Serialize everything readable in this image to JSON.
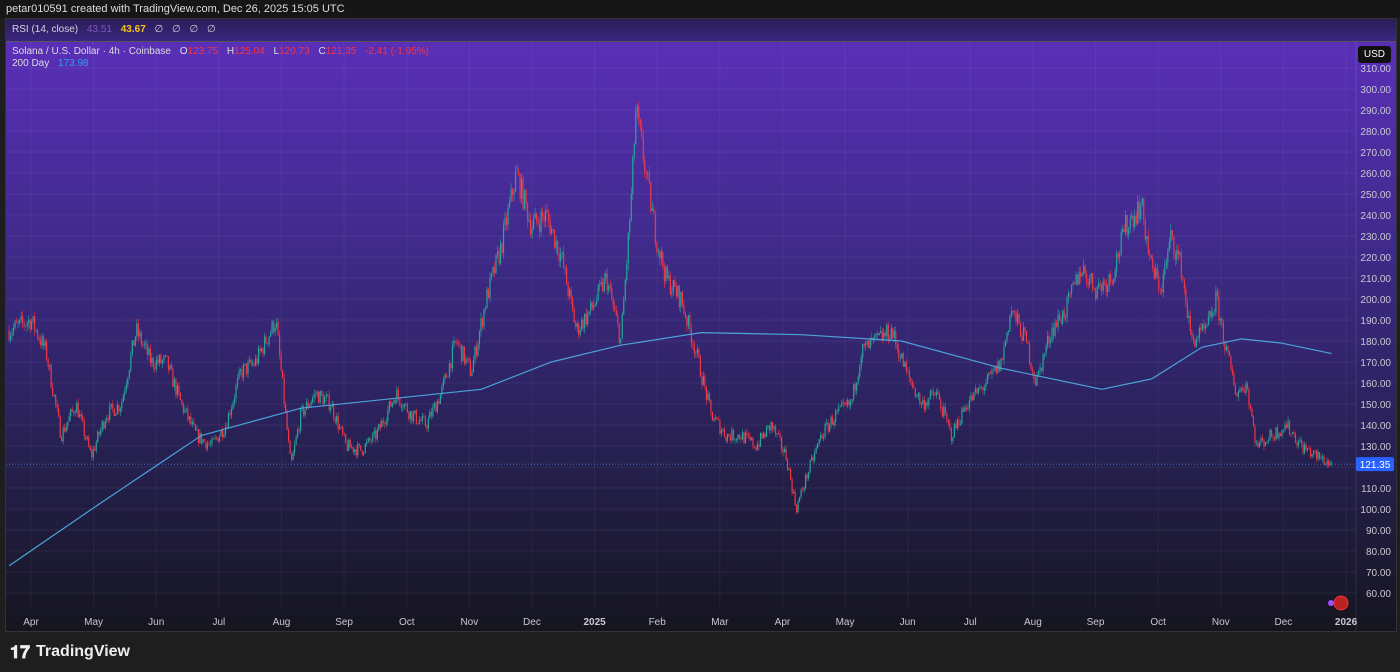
{
  "header": {
    "caption": "petar010591 created with TradingView.com, Dec 26, 2025 15:05 UTC"
  },
  "rsi": {
    "label": "RSI (14, close)",
    "value1": "43.51",
    "value2": "43.67",
    "nulls": [
      "∅",
      "∅",
      "∅",
      "∅"
    ]
  },
  "legend": {
    "symbol": "Solana / U.S. Dollar · 4h · Coinbase",
    "o_label": "O",
    "o": "123.75",
    "h_label": "H",
    "h": "125.04",
    "l_label": "L",
    "l": "120.73",
    "c_label": "C",
    "c": "121.35",
    "change": "-2.41 (-1.95%)",
    "ma_label": "200 Day",
    "ma_value": "173.98"
  },
  "currency": "USD",
  "brand": "TradingView",
  "colors": {
    "up": "#26a69a",
    "down": "#f23645",
    "ma": "#4aa3d9",
    "last": "#2962ff"
  },
  "chart_data": {
    "type": "candlestick",
    "title": "Solana / U.S. Dollar · 4h · Coinbase",
    "ylim": [
      55,
      315
    ],
    "yticks": [
      60,
      70,
      80,
      90,
      100,
      110,
      120,
      130,
      140,
      150,
      160,
      170,
      180,
      190,
      200,
      210,
      220,
      230,
      240,
      250,
      260,
      270,
      280,
      290,
      300,
      310
    ],
    "xticks": [
      {
        "t": 0,
        "label": "Apr"
      },
      {
        "t": 1,
        "label": "May"
      },
      {
        "t": 2,
        "label": "Jun"
      },
      {
        "t": 3,
        "label": "Jul"
      },
      {
        "t": 4,
        "label": "Aug"
      },
      {
        "t": 5,
        "label": "Sep"
      },
      {
        "t": 6,
        "label": "Oct"
      },
      {
        "t": 7,
        "label": "Nov"
      },
      {
        "t": 8,
        "label": "Dec"
      },
      {
        "t": 9,
        "label": "2025"
      },
      {
        "t": 10,
        "label": "Feb"
      },
      {
        "t": 11,
        "label": "Mar"
      },
      {
        "t": 12,
        "label": "Apr"
      },
      {
        "t": 13,
        "label": "May"
      },
      {
        "t": 14,
        "label": "Jun"
      },
      {
        "t": 15,
        "label": "Jul"
      },
      {
        "t": 16,
        "label": "Aug"
      },
      {
        "t": 17,
        "label": "Sep"
      },
      {
        "t": 18,
        "label": "Oct"
      },
      {
        "t": 19,
        "label": "Nov"
      },
      {
        "t": 20,
        "label": "Dec"
      },
      {
        "t": 21,
        "label": "2026"
      }
    ],
    "xunit": "months since Apr 2024",
    "price_path": [
      [
        -0.35,
        185
      ],
      [
        0,
        190
      ],
      [
        0.24,
        175
      ],
      [
        0.48,
        135
      ],
      [
        0.72,
        150
      ],
      [
        0.96,
        125
      ],
      [
        1.2,
        145
      ],
      [
        1.44,
        150
      ],
      [
        1.68,
        185
      ],
      [
        1.92,
        170
      ],
      [
        2.16,
        170
      ],
      [
        2.4,
        150
      ],
      [
        2.64,
        135
      ],
      [
        2.88,
        130
      ],
      [
        3.11,
        140
      ],
      [
        3.35,
        165
      ],
      [
        3.59,
        170
      ],
      [
        3.91,
        190
      ],
      [
        4.15,
        120
      ],
      [
        4.31,
        145
      ],
      [
        4.55,
        155
      ],
      [
        4.79,
        150
      ],
      [
        5.03,
        130
      ],
      [
        5.27,
        128
      ],
      [
        5.51,
        135
      ],
      [
        5.83,
        155
      ],
      [
        6.07,
        145
      ],
      [
        6.31,
        140
      ],
      [
        6.55,
        155
      ],
      [
        6.79,
        180
      ],
      [
        7.03,
        165
      ],
      [
        7.27,
        200
      ],
      [
        7.51,
        225
      ],
      [
        7.75,
        260
      ],
      [
        7.99,
        235
      ],
      [
        8.23,
        240
      ],
      [
        8.47,
        220
      ],
      [
        8.71,
        185
      ],
      [
        8.95,
        195
      ],
      [
        9.19,
        210
      ],
      [
        9.42,
        180
      ],
      [
        9.58,
        245
      ],
      [
        9.66,
        290
      ],
      [
        9.82,
        260
      ],
      [
        9.98,
        230
      ],
      [
        10.14,
        210
      ],
      [
        10.38,
        200
      ],
      [
        10.62,
        175
      ],
      [
        10.86,
        145
      ],
      [
        11.1,
        135
      ],
      [
        11.34,
        135
      ],
      [
        11.58,
        130
      ],
      [
        11.82,
        140
      ],
      [
        12.06,
        125
      ],
      [
        12.22,
        100
      ],
      [
        12.38,
        115
      ],
      [
        12.62,
        135
      ],
      [
        12.86,
        145
      ],
      [
        13.1,
        150
      ],
      [
        13.26,
        175
      ],
      [
        13.5,
        180
      ],
      [
        13.74,
        185
      ],
      [
        13.98,
        165
      ],
      [
        14.22,
        150
      ],
      [
        14.46,
        155
      ],
      [
        14.7,
        135
      ],
      [
        14.94,
        150
      ],
      [
        15.26,
        160
      ],
      [
        15.5,
        170
      ],
      [
        15.65,
        195
      ],
      [
        15.89,
        180
      ],
      [
        16.05,
        160
      ],
      [
        16.29,
        185
      ],
      [
        16.53,
        195
      ],
      [
        16.77,
        215
      ],
      [
        17.01,
        205
      ],
      [
        17.25,
        210
      ],
      [
        17.49,
        235
      ],
      [
        17.73,
        245
      ],
      [
        17.89,
        215
      ],
      [
        18.05,
        205
      ],
      [
        18.21,
        230
      ],
      [
        18.37,
        215
      ],
      [
        18.53,
        180
      ],
      [
        18.77,
        185
      ],
      [
        18.93,
        200
      ],
      [
        19.09,
        175
      ],
      [
        19.25,
        155
      ],
      [
        19.41,
        160
      ],
      [
        19.57,
        130
      ],
      [
        19.81,
        135
      ],
      [
        20.05,
        140
      ],
      [
        20.29,
        130
      ],
      [
        20.53,
        125
      ],
      [
        20.77,
        121.35
      ]
    ],
    "ma_200": [
      [
        -0.35,
        73
      ],
      [
        1.12,
        103
      ],
      [
        2.72,
        135
      ],
      [
        4.31,
        148
      ],
      [
        5.91,
        153
      ],
      [
        7.19,
        157
      ],
      [
        8.31,
        170
      ],
      [
        9.42,
        178
      ],
      [
        10.7,
        184
      ],
      [
        12.3,
        183
      ],
      [
        13.9,
        180
      ],
      [
        15.5,
        167
      ],
      [
        17.1,
        157
      ],
      [
        17.9,
        162
      ],
      [
        18.7,
        177
      ],
      [
        19.33,
        181
      ],
      [
        19.97,
        179
      ],
      [
        20.77,
        174
      ]
    ],
    "last_price": "121.35"
  }
}
